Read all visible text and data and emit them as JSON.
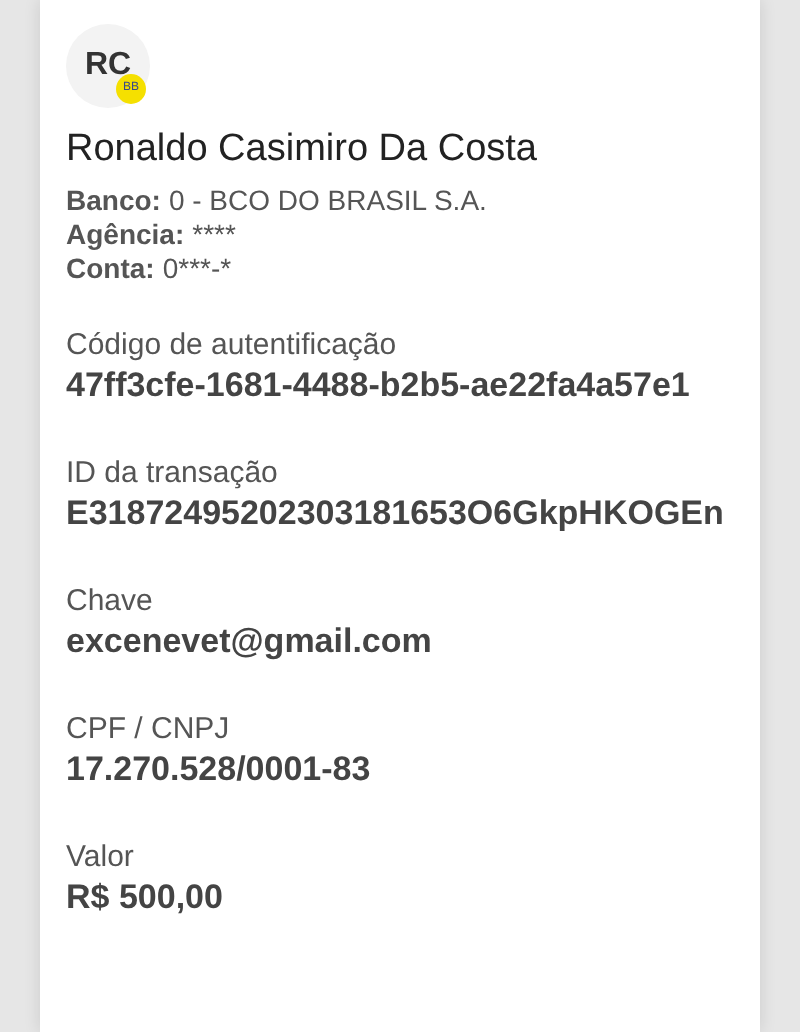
{
  "recipient": {
    "initials": "RC",
    "bank_badge": "BB",
    "name": "Ronaldo Casimiro Da Costa",
    "details": [
      {
        "label": "Banco:",
        "value": "0 - BCO DO BRASIL S.A."
      },
      {
        "label": "Agência:",
        "value": "****"
      },
      {
        "label": "Conta:",
        "value": "0***-*"
      }
    ]
  },
  "fields": [
    {
      "label": "Código de autentificação",
      "value": "47ff3cfe-1681-4488-b2b5-ae22fa4a57e1"
    },
    {
      "label": "ID da transação",
      "value": "E31872495202303181653O6GkpHKOGEn"
    },
    {
      "label": "Chave",
      "value": "excenevet@gmail.com"
    },
    {
      "label": "CPF / CNPJ",
      "value": "17.270.528/0001-83"
    },
    {
      "label": "Valor",
      "value": "R$ 500,00"
    }
  ]
}
